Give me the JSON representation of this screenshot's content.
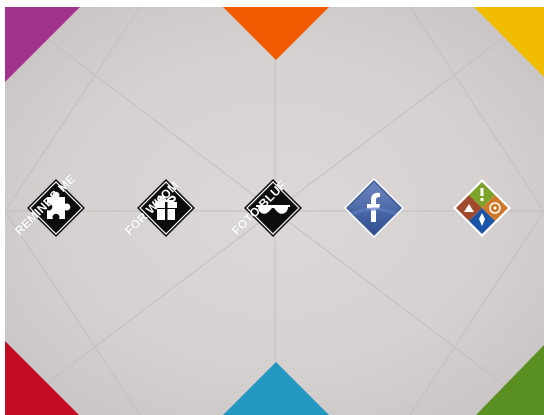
{
  "colors": {
    "corner_top_left": "#a2338d",
    "corner_top_center": "#f35a00",
    "corner_top_right": "#f0bb00",
    "corner_bottom_left": "#c40d25",
    "corner_bottom_center": "#2298c0",
    "corner_bottom_right": "#5a8f22",
    "tile_black": "#0d0d0d",
    "facebook_blue": "#3b5998"
  },
  "apps": [
    {
      "label": "REMINDS ME",
      "icon": "puzzle-piece-icon"
    },
    {
      "label": "FOR WHOM",
      "icon": "gift-icon"
    },
    {
      "label": "FOTO BLUF",
      "icon": "sunglasses-icon"
    },
    {
      "label": "",
      "icon": "facebook-icon"
    },
    {
      "label": "",
      "icon": "multicolor-app-icon"
    }
  ]
}
